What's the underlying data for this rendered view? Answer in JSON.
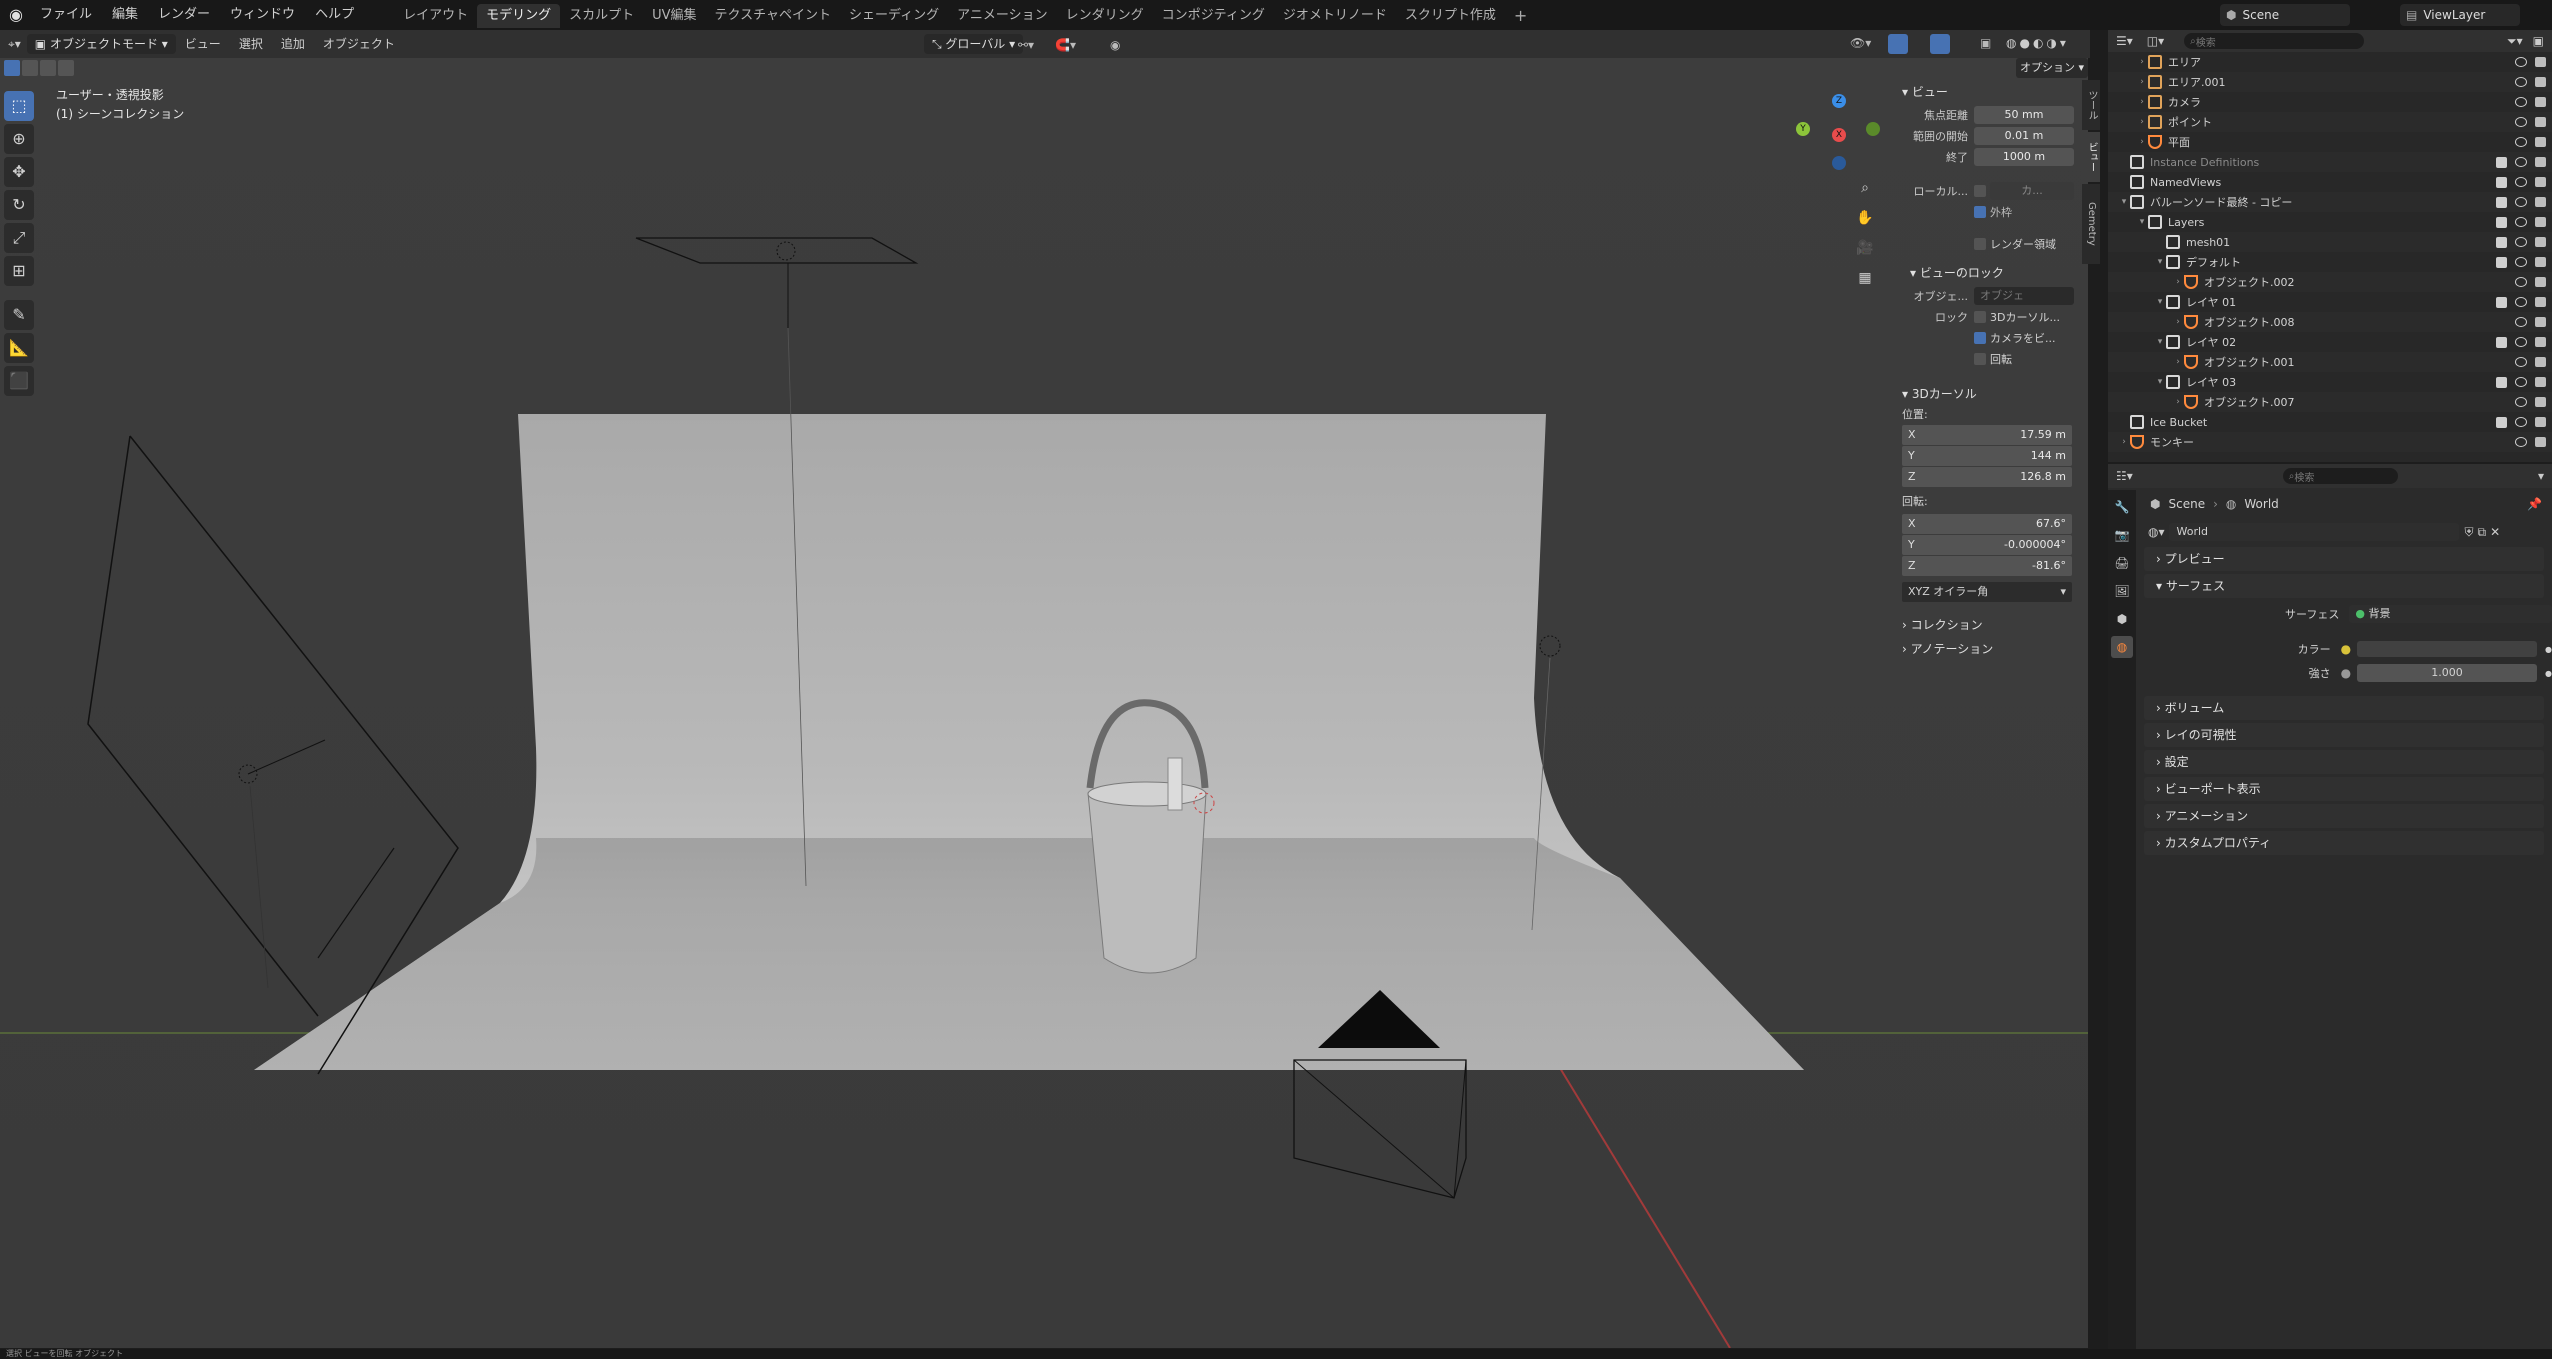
{
  "app": {
    "menu": [
      "ファイル",
      "編集",
      "レンダー",
      "ウィンドウ",
      "ヘルプ"
    ],
    "workspaces": [
      "レイアウト",
      "モデリング",
      "スカルプト",
      "UV編集",
      "テクスチャペイント",
      "シェーディング",
      "アニメーション",
      "レンダリング",
      "コンポジティング",
      "ジオメトリノード",
      "スクリプト作成"
    ],
    "active_workspace": "モデリング",
    "add_tab": "+",
    "scene_name": "Scene",
    "view_layer": "ViewLayer"
  },
  "viewport_header": {
    "mode": "オブジェクトモード",
    "menus": [
      "ビュー",
      "選択",
      "追加",
      "オブジェクト"
    ],
    "transform_orientation": "グローバル",
    "options": "オプション"
  },
  "viewport": {
    "view_title": "ユーザー・透視投影",
    "collection": "(1) シーンコレクション",
    "gizmo": {
      "x": "X",
      "y": "Y",
      "z": "Z"
    }
  },
  "sidebar": {
    "tabs": [
      "ツール",
      "ビュー",
      "Gemetry"
    ],
    "view_section": "ビュー",
    "focal_label": "焦点距離",
    "focal_value": "50 mm",
    "clip_start_label": "範囲の開始",
    "clip_start_value": "0.01 m",
    "clip_end_label": "終了",
    "clip_end_value": "1000 m",
    "local_label": "ローカル...",
    "local_value": "カ...",
    "outline_label": "外枠",
    "render_region_label": "レンダー領域",
    "view_lock_section": "ビューのロック",
    "object_label": "オブジェ...",
    "object_placeholder": "オブジェ",
    "lock_label": "ロック",
    "lock_3d_cursor": "3Dカーソル...",
    "lock_camera": "カメラをビ...",
    "lock_rotation": "回転",
    "cursor_section": "3Dカーソル",
    "location_label": "位置:",
    "loc_x": "17.59 m",
    "loc_y": "144 m",
    "loc_z": "126.8 m",
    "rotation_label": "回転:",
    "rot_x": "67.6°",
    "rot_y": "-0.000004°",
    "rot_z": "-81.6°",
    "rotation_mode": "XYZ オイラー角",
    "collection_section": "コレクション",
    "annotation_section": "アノテーション"
  },
  "outliner": {
    "search_placeholder": "検索",
    "rows": [
      {
        "label": "エリア",
        "indent": 1,
        "icon": "light",
        "hasChild": true
      },
      {
        "label": "エリア.001",
        "indent": 1,
        "icon": "light",
        "hasChild": true
      },
      {
        "label": "カメラ",
        "indent": 1,
        "icon": "camera",
        "hasChild": true
      },
      {
        "label": "ポイント",
        "indent": 1,
        "icon": "light",
        "hasChild": true
      },
      {
        "label": "平面",
        "indent": 1,
        "icon": "mesh",
        "hasChild": true
      },
      {
        "label": "Instance Definitions",
        "indent": 0,
        "icon": "collection",
        "hasChild": false,
        "dim": true
      },
      {
        "label": "NamedViews",
        "indent": 0,
        "icon": "collection",
        "hasChild": false
      },
      {
        "label": "バルーンソード最終 - コピー",
        "indent": 0,
        "icon": "collection",
        "hasChild": true,
        "open": true
      },
      {
        "label": "Layers",
        "indent": 1,
        "icon": "collection",
        "hasChild": true,
        "open": true
      },
      {
        "label": "mesh01",
        "indent": 2,
        "icon": "collection",
        "hasChild": false
      },
      {
        "label": "デフォルト",
        "indent": 2,
        "icon": "collection",
        "hasChild": true,
        "open": true
      },
      {
        "label": "オブジェクト.002",
        "indent": 3,
        "icon": "mesh",
        "hasChild": true
      },
      {
        "label": "レイヤ 01",
        "indent": 2,
        "icon": "collection",
        "hasChild": true,
        "open": true
      },
      {
        "label": "オブジェクト.008",
        "indent": 3,
        "icon": "mesh",
        "hasChild": true
      },
      {
        "label": "レイヤ 02",
        "indent": 2,
        "icon": "collection",
        "hasChild": true,
        "open": true
      },
      {
        "label": "オブジェクト.001",
        "indent": 3,
        "icon": "mesh",
        "hasChild": true
      },
      {
        "label": "レイヤ 03",
        "indent": 2,
        "icon": "collection",
        "hasChild": true,
        "open": true
      },
      {
        "label": "オブジェクト.007",
        "indent": 3,
        "icon": "mesh",
        "hasChild": true
      },
      {
        "label": "Ice Bucket",
        "indent": 0,
        "icon": "collection",
        "hasChild": false
      },
      {
        "label": "モンキー",
        "indent": 0,
        "icon": "mesh",
        "hasChild": true
      }
    ]
  },
  "properties": {
    "search_placeholder": "検索",
    "breadcrumb_scene": "Scene",
    "breadcrumb_world": "World",
    "world_name": "World",
    "sections": [
      "プレビュー",
      "サーフェス",
      "ボリューム",
      "レイの可視性",
      "設定",
      "ビューポート表示",
      "アニメーション",
      "カスタムプロパティ"
    ],
    "surface_label": "サーフェス",
    "surface_value": "背景",
    "color_label": "カラー",
    "strength_label": "強さ",
    "strength_value": "1.000"
  },
  "colors": {
    "accent": "#4772b3",
    "mesh_icon": "#ff8a3d",
    "light_icon": "#e0a35a",
    "x_axis": "#e84c4c",
    "y_axis": "#8cc43a",
    "z_axis": "#3a8ee8"
  },
  "status": "選択 ビューを回転 オブジェクト"
}
